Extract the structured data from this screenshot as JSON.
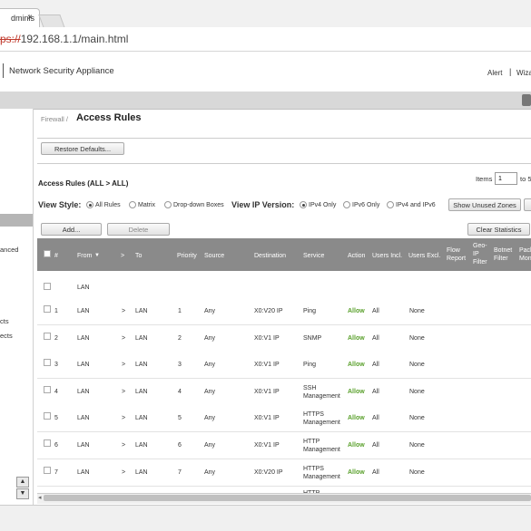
{
  "browser": {
    "tab_title": "dminis",
    "tab_close": "×",
    "url_proto": "ps://",
    "url_rest": "192.168.1.1/main.html"
  },
  "header": {
    "brand": "Network Security Appliance",
    "alert": "Alert",
    "separator": "|",
    "wizard": "Wiza"
  },
  "nav": {
    "items": [
      "anced",
      "cts",
      "ects"
    ],
    "scroll_up": "▲",
    "scroll_down": "▼"
  },
  "page": {
    "breadcrumb": "Firewall /",
    "title": "Access Rules",
    "restore_button": "Restore Defaults...",
    "section_title": "Access Rules (ALL > ALL)",
    "items_label": "Items",
    "items_value": "1",
    "items_to": "to 5"
  },
  "view": {
    "style_label": "View Style:",
    "style_options": [
      {
        "label": "All Rules",
        "selected": true
      },
      {
        "label": "Matrix",
        "selected": false
      },
      {
        "label": "Drop-down Boxes",
        "selected": false
      }
    ],
    "ip_label": "View IP Version:",
    "ip_options": [
      {
        "label": "IPv4 Only",
        "selected": true
      },
      {
        "label": "IPv6 Only",
        "selected": false
      },
      {
        "label": "IPv4 and IPv6",
        "selected": false
      }
    ],
    "show_unused_button": "Show Unused Zones"
  },
  "actions": {
    "add": "Add...",
    "delete": "Delete",
    "clear_stats": "Clear Statistics"
  },
  "table": {
    "headers": {
      "num": "#",
      "from": "From",
      "sort_icon": "▼",
      "arrow": ">",
      "to": "To",
      "priority": "Priority",
      "source": "Source",
      "destination": "Destination",
      "service": "Service",
      "action": "Action",
      "users_incl": "Users Incl.",
      "users_excl": "Users Excl.",
      "flow_report": "Flow\nReport",
      "geo_ip": "Geo-\nIP\nFilter",
      "botnet": "Botnet\nFilter",
      "packet": "Pack\nMoni"
    },
    "group_row": {
      "label": "LAN"
    },
    "rows": [
      {
        "num": "1",
        "from": "LAN",
        "arrow": ">",
        "to": "LAN",
        "priority": "1",
        "source": "Any",
        "destination": "X0:V20 IP",
        "service": "Ping",
        "action": "Allow",
        "users_incl": "All",
        "users_excl": "None"
      },
      {
        "num": "2",
        "from": "LAN",
        "arrow": ">",
        "to": "LAN",
        "priority": "2",
        "source": "Any",
        "destination": "X0:V1 IP",
        "service": "SNMP",
        "action": "Allow",
        "users_incl": "All",
        "users_excl": "None"
      },
      {
        "num": "3",
        "from": "LAN",
        "arrow": ">",
        "to": "LAN",
        "priority": "3",
        "source": "Any",
        "destination": "X0:V1 IP",
        "service": "Ping",
        "action": "Allow",
        "users_incl": "All",
        "users_excl": "None"
      },
      {
        "num": "4",
        "from": "LAN",
        "arrow": ">",
        "to": "LAN",
        "priority": "4",
        "source": "Any",
        "destination": "X0:V1 IP",
        "service": "SSH\nManagement",
        "action": "Allow",
        "users_incl": "All",
        "users_excl": "None"
      },
      {
        "num": "5",
        "from": "LAN",
        "arrow": ">",
        "to": "LAN",
        "priority": "5",
        "source": "Any",
        "destination": "X0:V1 IP",
        "service": "HTTPS\nManagement",
        "action": "Allow",
        "users_incl": "All",
        "users_excl": "None"
      },
      {
        "num": "6",
        "from": "LAN",
        "arrow": ">",
        "to": "LAN",
        "priority": "6",
        "source": "Any",
        "destination": "X0:V1 IP",
        "service": "HTTP\nManagement",
        "action": "Allow",
        "users_incl": "All",
        "users_excl": "None"
      },
      {
        "num": "7",
        "from": "LAN",
        "arrow": ">",
        "to": "LAN",
        "priority": "7",
        "source": "Any",
        "destination": "X0:V20 IP",
        "service": "HTTPS\nManagement",
        "action": "Allow",
        "users_incl": "All",
        "users_excl": "None"
      }
    ],
    "partial_row_service": "HTTP"
  },
  "colors": {
    "allow": "#5aa02c",
    "table_header": "#8a8a8a",
    "nav_selected": "#b5b5b5"
  }
}
